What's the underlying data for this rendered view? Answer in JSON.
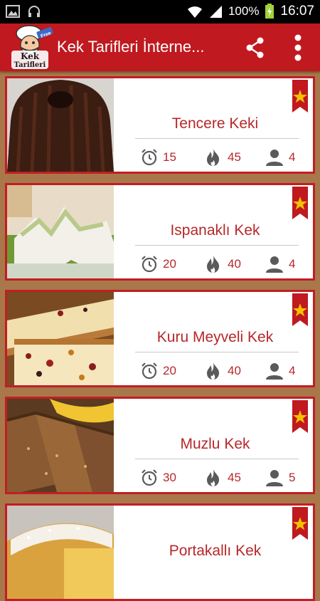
{
  "status_bar": {
    "battery": "100%",
    "time": "16:07"
  },
  "app_bar": {
    "logo_text": [
      "Kek",
      "Tarifleri"
    ],
    "logo_badge": "Free",
    "title": "Kek Tarifleri İnterne..."
  },
  "recipes": [
    {
      "name": "Tencere Keki",
      "time": "15",
      "calories": "45",
      "servings": "4"
    },
    {
      "name": "Ispanaklı Kek",
      "time": "20",
      "calories": "40",
      "servings": "4"
    },
    {
      "name": "Kuru Meyveli Kek",
      "time": "20",
      "calories": "40",
      "servings": "4"
    },
    {
      "name": "Muzlu Kek",
      "time": "30",
      "calories": "45",
      "servings": "5"
    },
    {
      "name": "Portakallı Kek",
      "time": "",
      "calories": "",
      "servings": ""
    }
  ],
  "colors": {
    "accent": "#c0191f",
    "text_red": "#b7272a",
    "background": "#a8784a"
  }
}
